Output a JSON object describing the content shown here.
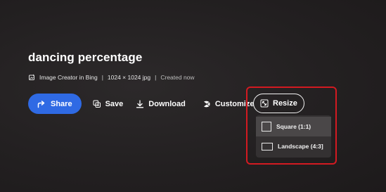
{
  "image": {
    "title": "dancing percentage",
    "source": "Image Creator in Bing",
    "separator": "|",
    "dimensions": "1024 × 1024 jpg",
    "created": "Created now"
  },
  "toolbar": {
    "share_label": "Share",
    "save_label": "Save",
    "download_label": "Download",
    "customize_label": "Customize",
    "resize_label": "Resize"
  },
  "resize_menu": {
    "options": [
      {
        "label": "Square (1:1)",
        "icon": "square-icon",
        "selected": true
      },
      {
        "label": "Landscape (4:3]",
        "icon": "landscape-icon",
        "selected": false
      }
    ]
  },
  "colors": {
    "background": "#221f20",
    "share_button": "#2f6ae4",
    "highlight": "#d31a21",
    "menu_background": "#343132"
  }
}
